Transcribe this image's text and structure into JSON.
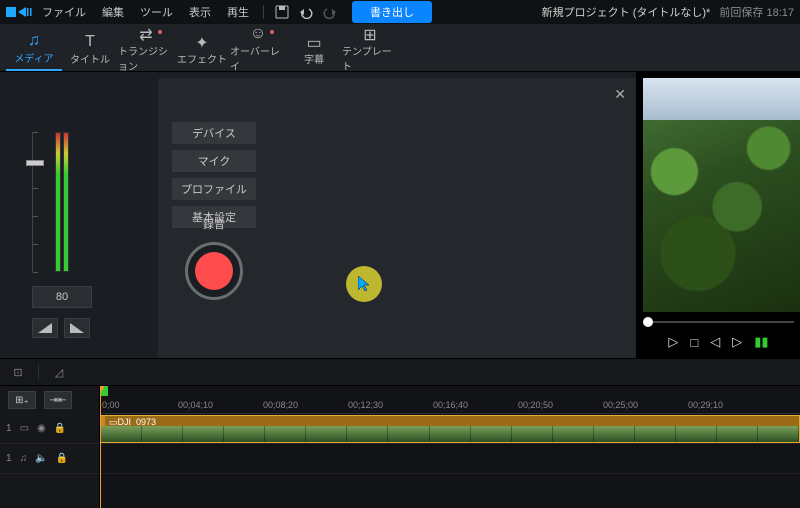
{
  "menubar": {
    "items": [
      "ファイル",
      "編集",
      "ツール",
      "表示",
      "再生"
    ],
    "export_label": "書き出し",
    "project_title": "新規プロジェクト (タイトルなし)*",
    "autosave_prefix": "前回保存",
    "autosave_time": "18:17"
  },
  "tooltabs": [
    {
      "label": "メディア",
      "active": true
    },
    {
      "label": "タイトル"
    },
    {
      "label": "トランジション",
      "dot": true
    },
    {
      "label": "エフェクト"
    },
    {
      "label": "オーバーレイ",
      "dot": true
    },
    {
      "label": "字幕"
    },
    {
      "label": "テンプレート"
    }
  ],
  "audio": {
    "volume": "80"
  },
  "rec_panel": {
    "tabs": [
      "デバイス",
      "マイク",
      "プロファイル",
      "基本設定"
    ],
    "record_label": "録音"
  },
  "ruler": [
    "0;00",
    "00;04;10",
    "00;08;20",
    "00;12;30",
    "00;16;40",
    "00;20;50",
    "00;25;00",
    "00;29;10"
  ],
  "tracks": {
    "video": {
      "num": "1"
    },
    "audio": {
      "num": "1"
    }
  },
  "clip": {
    "name": "DJI_0973"
  }
}
